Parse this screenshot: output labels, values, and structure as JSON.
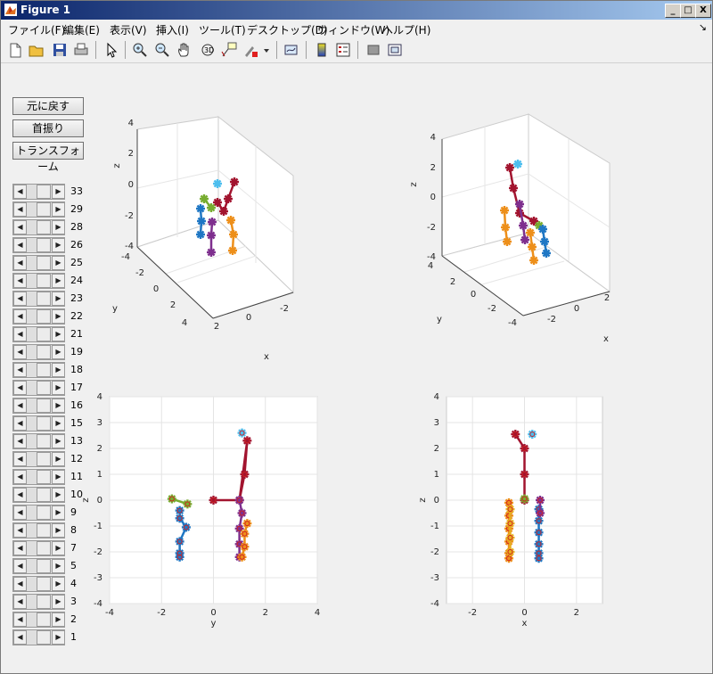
{
  "window": {
    "title": "Figure 1",
    "min": "_",
    "max": "□",
    "close": "X"
  },
  "menu": [
    "ファイル(F)",
    "編集(E)",
    "表示(V)",
    "挿入(I)",
    "ツール(T)",
    "デスクトップ(D)",
    "ウィンドウ(W)",
    "ヘルプ(H)"
  ],
  "toolbar": [
    "new-figure-icon",
    "open-file-icon",
    "save-icon",
    "print-icon",
    "pointer-icon",
    "zoom-in-icon",
    "zoom-out-icon",
    "pan-icon",
    "rotate-3d-icon",
    "data-cursor-icon",
    "brush-icon",
    "link-plot-icon",
    "colorbar-icon",
    "legend-icon",
    "hide-plot-tools-icon",
    "show-plot-tools-icon"
  ],
  "buttons": {
    "reset": "元に戻す",
    "swing": "首振り",
    "transform": "トランスフォーム"
  },
  "sliders": [
    "33",
    "29",
    "28",
    "26",
    "25",
    "24",
    "23",
    "22",
    "21",
    "19",
    "18",
    "17",
    "16",
    "15",
    "13",
    "12",
    "11",
    "10",
    "9",
    "8",
    "7",
    "5",
    "4",
    "3",
    "2",
    "1"
  ],
  "colors": {
    "dark_red": "#a2142f",
    "orange": "#ed8f1a",
    "blue": "#1f77c4",
    "purple": "#7e2f8e",
    "green": "#77ac30",
    "light_blue": "#4dbeee",
    "yellow": "#e6b020",
    "bone_red": "#d02020"
  },
  "chart_data": [
    {
      "type": "scatter",
      "view": "3d",
      "xlabel": "x",
      "ylabel": "y",
      "zlabel": "z",
      "xticks": [
        "2",
        "0",
        "-2"
      ],
      "yticks": [
        "-4",
        "-2",
        "0",
        "2",
        "4"
      ],
      "zticks": [
        "4",
        "2",
        "0",
        "-2",
        "-4"
      ]
    },
    {
      "type": "scatter",
      "view": "3d",
      "xlabel": "x",
      "ylabel": "y",
      "zlabel": "z",
      "xticks": [
        "-2",
        "0",
        "2"
      ],
      "yticks": [
        "4",
        "2",
        "0",
        "-2",
        "-4"
      ],
      "zticks": [
        "4",
        "2",
        "0",
        "-2",
        "-4"
      ]
    },
    {
      "type": "scatter",
      "view": "yz",
      "xlabel": "y",
      "ylabel": "z",
      "xlim": [
        -4,
        4
      ],
      "ylim": [
        -4,
        4
      ],
      "xticks": [
        "-4",
        "-2",
        "0",
        "2",
        "4"
      ],
      "yticks": [
        "4",
        "3",
        "2",
        "1",
        "0",
        "-1",
        "-2",
        "-3",
        "-4"
      ],
      "series": [
        {
          "color": "dark_red",
          "points": [
            [
              0,
              0
            ],
            [
              1.0,
              0
            ],
            [
              1.2,
              1.0
            ],
            [
              1.3,
              2.3
            ],
            [
              1.0,
              0
            ]
          ]
        },
        {
          "color": "light_blue",
          "points": [
            [
              1.1,
              2.6
            ]
          ]
        },
        {
          "color": "green",
          "points": [
            [
              -1.6,
              0.05
            ],
            [
              -1.0,
              -0.15
            ]
          ]
        },
        {
          "color": "blue",
          "points": [
            [
              -1.3,
              -0.4
            ],
            [
              -1.3,
              -0.7
            ],
            [
              -1.05,
              -1.05
            ],
            [
              -1.3,
              -1.6
            ],
            [
              -1.3,
              -2.05
            ],
            [
              -1.3,
              -2.2
            ]
          ]
        },
        {
          "color": "purple",
          "points": [
            [
              1.0,
              0
            ],
            [
              1.1,
              -0.5
            ],
            [
              1.0,
              -1.1
            ],
            [
              1.0,
              -1.7
            ],
            [
              1.0,
              -2.2
            ]
          ]
        },
        {
          "color": "orange",
          "points": [
            [
              1.3,
              -0.9
            ],
            [
              1.2,
              -1.3
            ],
            [
              1.2,
              -1.8
            ],
            [
              1.1,
              -2.2
            ]
          ]
        }
      ]
    },
    {
      "type": "scatter",
      "view": "xz",
      "xlabel": "x",
      "ylabel": "z",
      "xlim": [
        -3,
        3
      ],
      "ylim": [
        -4,
        4
      ],
      "xticks": [
        "-2",
        "0",
        "2"
      ],
      "yticks": [
        "4",
        "3",
        "2",
        "1",
        "0",
        "-1",
        "-2",
        "-3",
        "-4"
      ],
      "series": [
        {
          "color": "dark_red",
          "points": [
            [
              0,
              0
            ],
            [
              0,
              1.0
            ],
            [
              0,
              2.0
            ],
            [
              -0.35,
              2.55
            ]
          ]
        },
        {
          "color": "light_blue",
          "points": [
            [
              0.3,
              2.55
            ]
          ]
        },
        {
          "color": "green",
          "points": [
            [
              0,
              0.05
            ]
          ]
        },
        {
          "color": "blue",
          "points": [
            [
              0.55,
              -0.35
            ],
            [
              0.55,
              -0.8
            ],
            [
              0.55,
              -1.25
            ],
            [
              0.55,
              -1.7
            ],
            [
              0.55,
              -2.05
            ],
            [
              0.55,
              -2.25
            ]
          ]
        },
        {
          "color": "purple",
          "points": [
            [
              0.6,
              0
            ],
            [
              0.6,
              -0.5
            ]
          ]
        },
        {
          "color": "orange",
          "points": [
            [
              -0.6,
              -0.1
            ],
            [
              -0.6,
              -0.6
            ],
            [
              -0.6,
              -1.1
            ],
            [
              -0.6,
              -1.6
            ],
            [
              -0.6,
              -2.05
            ],
            [
              -0.6,
              -2.25
            ]
          ]
        },
        {
          "color": "yellow",
          "points": [
            [
              -0.55,
              -0.35
            ],
            [
              -0.55,
              -0.9
            ],
            [
              -0.55,
              -1.45
            ],
            [
              -0.55,
              -2.0
            ]
          ]
        }
      ]
    }
  ]
}
